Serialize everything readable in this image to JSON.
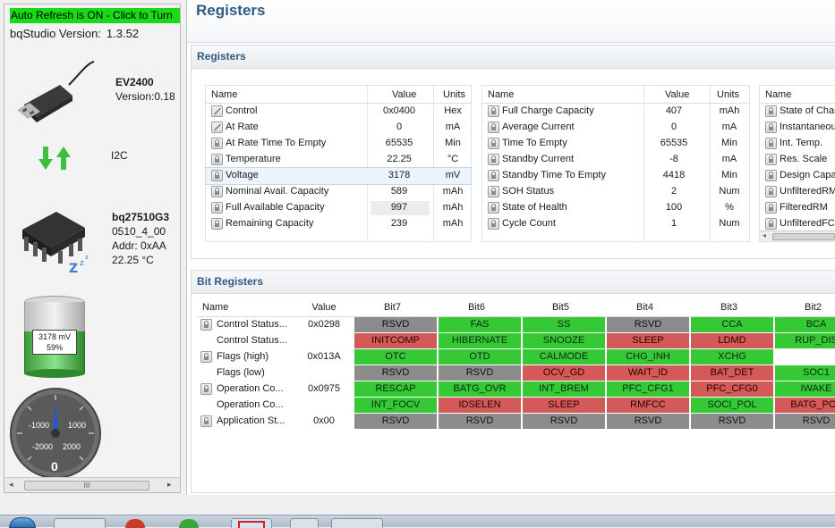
{
  "left": {
    "refresh_label": "Auto Refresh is ON - Click to Turn",
    "version_label": "bqStudio Version:",
    "version_value": "1.3.52",
    "adapter_name": "EV2400",
    "adapter_version": "Version:0.18",
    "protocol": "I2C",
    "gauge_name": "bq27510G3",
    "gauge_fw": "0510_4_00",
    "gauge_addr": "Addr: 0xAA",
    "gauge_temp": "22.25 °C",
    "battery_mv": "3178 mV",
    "battery_pct": "59%",
    "battery_level": 0.59,
    "dial_value": "0",
    "dial_ticks": [
      "-1000",
      "1000",
      "-2000",
      "2000"
    ],
    "scroll_label": "III"
  },
  "page_title": "Registers",
  "registers_section": "Registers",
  "bit_section": "Bit Registers",
  "reg_headers": {
    "name": "Name",
    "value": "Value",
    "units": "Units"
  },
  "reg_table_1": [
    {
      "name": "Control",
      "value": "0x0400",
      "units": "Hex",
      "icon": "pen-icon"
    },
    {
      "name": "At Rate",
      "value": "0",
      "units": "mA",
      "icon": "pen-icon"
    },
    {
      "name": "At Rate Time To Empty",
      "value": "65535",
      "units": "Min",
      "icon": "lock-icon"
    },
    {
      "name": "Temperature",
      "value": "22.25",
      "units": "°C",
      "icon": "lock-icon"
    },
    {
      "name": "Voltage",
      "value": "3178",
      "units": "mV",
      "icon": "lock-icon"
    },
    {
      "name": "Nominal Avail. Capacity",
      "value": "589",
      "units": "mAh",
      "icon": "lock-icon"
    },
    {
      "name": "Full Available Capacity",
      "value": "997",
      "units": "mAh",
      "icon": "lock-icon"
    },
    {
      "name": "Remaining Capacity",
      "value": "239",
      "units": "mAh",
      "icon": "lock-icon"
    }
  ],
  "reg_table_2": [
    {
      "name": "Full Charge Capacity",
      "value": "407",
      "units": "mAh"
    },
    {
      "name": "Average Current",
      "value": "0",
      "units": "mA"
    },
    {
      "name": "Time To Empty",
      "value": "65535",
      "units": "Min"
    },
    {
      "name": "Standby Current",
      "value": "-8",
      "units": "mA"
    },
    {
      "name": "Standby Time To Empty",
      "value": "4418",
      "units": "Min"
    },
    {
      "name": "SOH Status",
      "value": "2",
      "units": "Num"
    },
    {
      "name": "State of Health",
      "value": "100",
      "units": "%"
    },
    {
      "name": "Cycle Count",
      "value": "1",
      "units": "Num"
    }
  ],
  "reg_table_3": [
    {
      "name": "State of Char"
    },
    {
      "name": "Instantaneous"
    },
    {
      "name": "Int. Temp."
    },
    {
      "name": "Res. Scale"
    },
    {
      "name": "Design Capac"
    },
    {
      "name": "UnfilteredRM"
    },
    {
      "name": "FilteredRM"
    },
    {
      "name": "UnfilteredFCC"
    }
  ],
  "bit_headers": [
    "Name",
    "Value",
    "Bit7",
    "Bit6",
    "Bit5",
    "Bit4",
    "Bit3",
    "Bit2"
  ],
  "bit_rows": [
    {
      "name": "Control Status...",
      "value": "0x0298",
      "lock": true,
      "bits": [
        [
          "RSVD",
          "y"
        ],
        [
          "FAS",
          "g"
        ],
        [
          "SS",
          "g"
        ],
        [
          "RSVD",
          "y"
        ],
        [
          "CCA",
          "g"
        ],
        [
          "BCA",
          "g"
        ]
      ]
    },
    {
      "name": "Control Status...",
      "value": "",
      "lock": false,
      "bits": [
        [
          "INITCOMP",
          "r"
        ],
        [
          "HIBERNATE",
          "g"
        ],
        [
          "SNOOZE",
          "g"
        ],
        [
          "SLEEP",
          "r"
        ],
        [
          "LDMD",
          "r"
        ],
        [
          "RUP_DIS",
          "g"
        ]
      ]
    },
    {
      "name": "Flags (high)",
      "value": "0x013A",
      "lock": true,
      "bits": [
        [
          "OTC",
          "g"
        ],
        [
          "OTD",
          "g"
        ],
        [
          "CALMODE",
          "g"
        ],
        [
          "CHG_INH",
          "g"
        ],
        [
          "XCHG",
          "g"
        ],
        [
          "",
          ""
        ]
      ]
    },
    {
      "name": "Flags (low)",
      "value": "",
      "lock": false,
      "bits": [
        [
          "RSVD",
          "y"
        ],
        [
          "RSVD",
          "y"
        ],
        [
          "OCV_GD",
          "r"
        ],
        [
          "WAIT_ID",
          "r"
        ],
        [
          "BAT_DET",
          "r"
        ],
        [
          "SOC1",
          "g"
        ]
      ]
    },
    {
      "name": "Operation Co...",
      "value": "0x0975",
      "lock": true,
      "bits": [
        [
          "RESCAP",
          "g"
        ],
        [
          "BATG_OVR",
          "g"
        ],
        [
          "INT_BREM",
          "g"
        ],
        [
          "PFC_CFG1",
          "g"
        ],
        [
          "PFC_CFG0",
          "r"
        ],
        [
          "IWAKE",
          "g"
        ]
      ]
    },
    {
      "name": "Operation Co...",
      "value": "",
      "lock": false,
      "bits": [
        [
          "INT_FOCV",
          "g"
        ],
        [
          "IDSELEN",
          "r"
        ],
        [
          "SLEEP",
          "r"
        ],
        [
          "RMFCC",
          "r"
        ],
        [
          "SOCI_POL",
          "g"
        ],
        [
          "BATG_POL",
          "r"
        ]
      ]
    },
    {
      "name": "Application St...",
      "value": "0x00",
      "lock": true,
      "bits": [
        [
          "RSVD",
          "y"
        ],
        [
          "RSVD",
          "y"
        ],
        [
          "RSVD",
          "y"
        ],
        [
          "RSVD",
          "y"
        ],
        [
          "RSVD",
          "y"
        ],
        [
          "RSVD",
          "y"
        ]
      ]
    }
  ]
}
